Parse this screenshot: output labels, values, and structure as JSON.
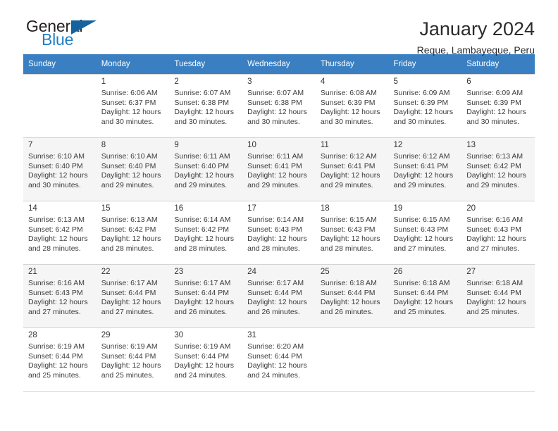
{
  "brand": {
    "name_top": "General",
    "name_bottom": "Blue",
    "accent_color": "#14639e",
    "text_color": "#1f7fc4"
  },
  "header": {
    "title": "January 2024",
    "subtitle": "Reque, Lambayeque, Peru"
  },
  "theme": {
    "header_row_bg": "#3a7fc1",
    "header_row_text": "#ffffff",
    "shaded_row_bg": "#f5f5f5",
    "grid_line": "#d4d4d4"
  },
  "weekdays": [
    "Sunday",
    "Monday",
    "Tuesday",
    "Wednesday",
    "Thursday",
    "Friday",
    "Saturday"
  ],
  "weeks": [
    {
      "shaded": false,
      "days": [
        {
          "num": "",
          "sunrise": "",
          "sunset": "",
          "daylight1": "",
          "daylight2": ""
        },
        {
          "num": "1",
          "sunrise": "Sunrise: 6:06 AM",
          "sunset": "Sunset: 6:37 PM",
          "daylight1": "Daylight: 12 hours",
          "daylight2": "and 30 minutes."
        },
        {
          "num": "2",
          "sunrise": "Sunrise: 6:07 AM",
          "sunset": "Sunset: 6:38 PM",
          "daylight1": "Daylight: 12 hours",
          "daylight2": "and 30 minutes."
        },
        {
          "num": "3",
          "sunrise": "Sunrise: 6:07 AM",
          "sunset": "Sunset: 6:38 PM",
          "daylight1": "Daylight: 12 hours",
          "daylight2": "and 30 minutes."
        },
        {
          "num": "4",
          "sunrise": "Sunrise: 6:08 AM",
          "sunset": "Sunset: 6:39 PM",
          "daylight1": "Daylight: 12 hours",
          "daylight2": "and 30 minutes."
        },
        {
          "num": "5",
          "sunrise": "Sunrise: 6:09 AM",
          "sunset": "Sunset: 6:39 PM",
          "daylight1": "Daylight: 12 hours",
          "daylight2": "and 30 minutes."
        },
        {
          "num": "6",
          "sunrise": "Sunrise: 6:09 AM",
          "sunset": "Sunset: 6:39 PM",
          "daylight1": "Daylight: 12 hours",
          "daylight2": "and 30 minutes."
        }
      ]
    },
    {
      "shaded": true,
      "days": [
        {
          "num": "7",
          "sunrise": "Sunrise: 6:10 AM",
          "sunset": "Sunset: 6:40 PM",
          "daylight1": "Daylight: 12 hours",
          "daylight2": "and 30 minutes."
        },
        {
          "num": "8",
          "sunrise": "Sunrise: 6:10 AM",
          "sunset": "Sunset: 6:40 PM",
          "daylight1": "Daylight: 12 hours",
          "daylight2": "and 29 minutes."
        },
        {
          "num": "9",
          "sunrise": "Sunrise: 6:11 AM",
          "sunset": "Sunset: 6:40 PM",
          "daylight1": "Daylight: 12 hours",
          "daylight2": "and 29 minutes."
        },
        {
          "num": "10",
          "sunrise": "Sunrise: 6:11 AM",
          "sunset": "Sunset: 6:41 PM",
          "daylight1": "Daylight: 12 hours",
          "daylight2": "and 29 minutes."
        },
        {
          "num": "11",
          "sunrise": "Sunrise: 6:12 AM",
          "sunset": "Sunset: 6:41 PM",
          "daylight1": "Daylight: 12 hours",
          "daylight2": "and 29 minutes."
        },
        {
          "num": "12",
          "sunrise": "Sunrise: 6:12 AM",
          "sunset": "Sunset: 6:41 PM",
          "daylight1": "Daylight: 12 hours",
          "daylight2": "and 29 minutes."
        },
        {
          "num": "13",
          "sunrise": "Sunrise: 6:13 AM",
          "sunset": "Sunset: 6:42 PM",
          "daylight1": "Daylight: 12 hours",
          "daylight2": "and 29 minutes."
        }
      ]
    },
    {
      "shaded": false,
      "days": [
        {
          "num": "14",
          "sunrise": "Sunrise: 6:13 AM",
          "sunset": "Sunset: 6:42 PM",
          "daylight1": "Daylight: 12 hours",
          "daylight2": "and 28 minutes."
        },
        {
          "num": "15",
          "sunrise": "Sunrise: 6:13 AM",
          "sunset": "Sunset: 6:42 PM",
          "daylight1": "Daylight: 12 hours",
          "daylight2": "and 28 minutes."
        },
        {
          "num": "16",
          "sunrise": "Sunrise: 6:14 AM",
          "sunset": "Sunset: 6:42 PM",
          "daylight1": "Daylight: 12 hours",
          "daylight2": "and 28 minutes."
        },
        {
          "num": "17",
          "sunrise": "Sunrise: 6:14 AM",
          "sunset": "Sunset: 6:43 PM",
          "daylight1": "Daylight: 12 hours",
          "daylight2": "and 28 minutes."
        },
        {
          "num": "18",
          "sunrise": "Sunrise: 6:15 AM",
          "sunset": "Sunset: 6:43 PM",
          "daylight1": "Daylight: 12 hours",
          "daylight2": "and 28 minutes."
        },
        {
          "num": "19",
          "sunrise": "Sunrise: 6:15 AM",
          "sunset": "Sunset: 6:43 PM",
          "daylight1": "Daylight: 12 hours",
          "daylight2": "and 27 minutes."
        },
        {
          "num": "20",
          "sunrise": "Sunrise: 6:16 AM",
          "sunset": "Sunset: 6:43 PM",
          "daylight1": "Daylight: 12 hours",
          "daylight2": "and 27 minutes."
        }
      ]
    },
    {
      "shaded": true,
      "days": [
        {
          "num": "21",
          "sunrise": "Sunrise: 6:16 AM",
          "sunset": "Sunset: 6:43 PM",
          "daylight1": "Daylight: 12 hours",
          "daylight2": "and 27 minutes."
        },
        {
          "num": "22",
          "sunrise": "Sunrise: 6:17 AM",
          "sunset": "Sunset: 6:44 PM",
          "daylight1": "Daylight: 12 hours",
          "daylight2": "and 27 minutes."
        },
        {
          "num": "23",
          "sunrise": "Sunrise: 6:17 AM",
          "sunset": "Sunset: 6:44 PM",
          "daylight1": "Daylight: 12 hours",
          "daylight2": "and 26 minutes."
        },
        {
          "num": "24",
          "sunrise": "Sunrise: 6:17 AM",
          "sunset": "Sunset: 6:44 PM",
          "daylight1": "Daylight: 12 hours",
          "daylight2": "and 26 minutes."
        },
        {
          "num": "25",
          "sunrise": "Sunrise: 6:18 AM",
          "sunset": "Sunset: 6:44 PM",
          "daylight1": "Daylight: 12 hours",
          "daylight2": "and 26 minutes."
        },
        {
          "num": "26",
          "sunrise": "Sunrise: 6:18 AM",
          "sunset": "Sunset: 6:44 PM",
          "daylight1": "Daylight: 12 hours",
          "daylight2": "and 25 minutes."
        },
        {
          "num": "27",
          "sunrise": "Sunrise: 6:18 AM",
          "sunset": "Sunset: 6:44 PM",
          "daylight1": "Daylight: 12 hours",
          "daylight2": "and 25 minutes."
        }
      ]
    },
    {
      "shaded": false,
      "days": [
        {
          "num": "28",
          "sunrise": "Sunrise: 6:19 AM",
          "sunset": "Sunset: 6:44 PM",
          "daylight1": "Daylight: 12 hours",
          "daylight2": "and 25 minutes."
        },
        {
          "num": "29",
          "sunrise": "Sunrise: 6:19 AM",
          "sunset": "Sunset: 6:44 PM",
          "daylight1": "Daylight: 12 hours",
          "daylight2": "and 25 minutes."
        },
        {
          "num": "30",
          "sunrise": "Sunrise: 6:19 AM",
          "sunset": "Sunset: 6:44 PM",
          "daylight1": "Daylight: 12 hours",
          "daylight2": "and 24 minutes."
        },
        {
          "num": "31",
          "sunrise": "Sunrise: 6:20 AM",
          "sunset": "Sunset: 6:44 PM",
          "daylight1": "Daylight: 12 hours",
          "daylight2": "and 24 minutes."
        },
        {
          "num": "",
          "sunrise": "",
          "sunset": "",
          "daylight1": "",
          "daylight2": ""
        },
        {
          "num": "",
          "sunrise": "",
          "sunset": "",
          "daylight1": "",
          "daylight2": ""
        },
        {
          "num": "",
          "sunrise": "",
          "sunset": "",
          "daylight1": "",
          "daylight2": ""
        }
      ]
    }
  ]
}
